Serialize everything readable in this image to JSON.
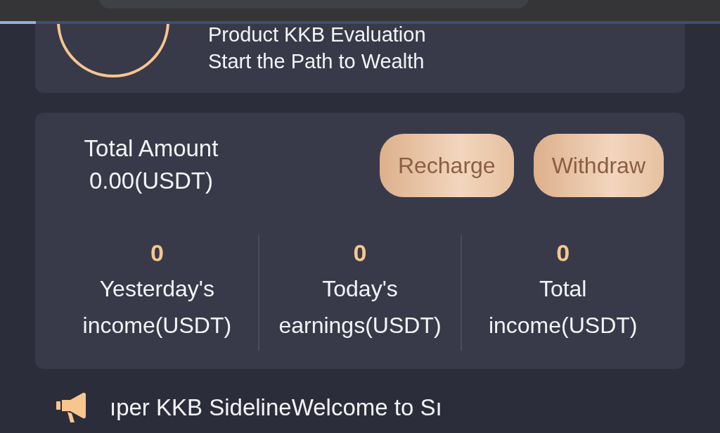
{
  "loading_bar": {
    "level": 0.05
  },
  "intro": {
    "lines": [
      "Product KKB Evaluation",
      "Start the Path to Wealth"
    ]
  },
  "account": {
    "total_label": "Total Amount",
    "total_value": "0.00(USDT)",
    "buttons": [
      "Recharge",
      "Withdraw"
    ],
    "stats": [
      {
        "value": "0",
        "label": "Yesterday's income(USDT)"
      },
      {
        "value": "0",
        "label": "Today's earnings(USDT)"
      },
      {
        "value": "0",
        "label": "Total income(USDT)"
      }
    ]
  },
  "notice": {
    "text": "ıper KKB SidelineWelcome to Sı"
  }
}
